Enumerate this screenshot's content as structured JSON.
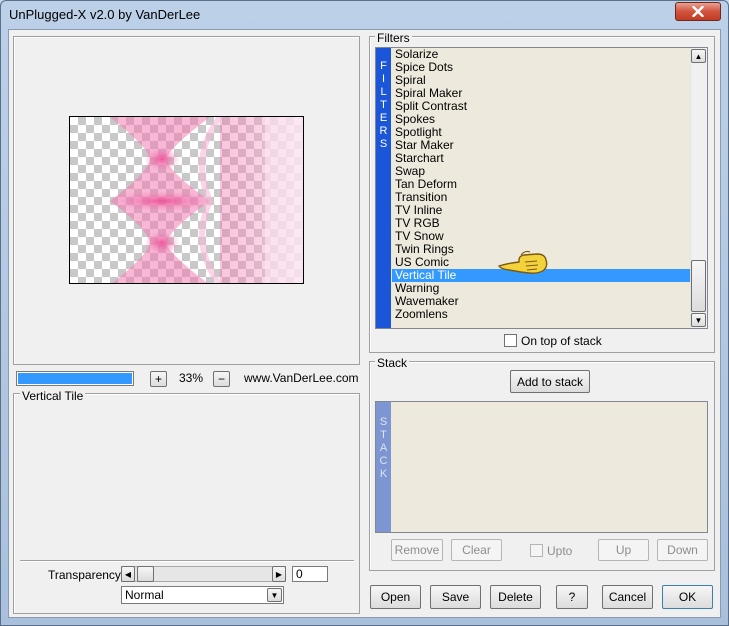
{
  "window": {
    "title": "UnPlugged-X v2.0 by VanDerLee"
  },
  "preview": {
    "progress": 1.0,
    "zoom": "33%",
    "zoom_in_label": "+",
    "zoom_out_label": "−",
    "website": "www.VanDerLee.com"
  },
  "settings": {
    "filter_name": "Vertical Tile",
    "transparency_label": "Transparency",
    "transparency_value": "0",
    "blend_mode": "Normal"
  },
  "filters": {
    "title": "Filters",
    "sidebar_letters": [
      "F",
      "I",
      "L",
      "T",
      "E",
      "R",
      "S"
    ],
    "items": [
      "Solarize",
      "Spice Dots",
      "Spiral",
      "Spiral Maker",
      "Split Contrast",
      "Spokes",
      "Spotlight",
      "Star Maker",
      "Starchart",
      "Swap",
      "Tan Deform",
      "Transition",
      "TV Inline",
      "TV RGB",
      "TV Snow",
      "Twin Rings",
      "US Comic",
      "Vertical Tile",
      "Warning",
      "Wavemaker",
      "Zoomlens"
    ],
    "selected": "Vertical Tile",
    "on_top_label": "On top of stack"
  },
  "stack": {
    "title": "Stack",
    "add_label": "Add to stack",
    "sidebar_letters": [
      "S",
      "T",
      "A",
      "C",
      "K"
    ],
    "remove_label": "Remove",
    "clear_label": "Clear",
    "upto_label": "Upto",
    "up_label": "Up",
    "down_label": "Down"
  },
  "buttons": {
    "open": "Open",
    "save": "Save",
    "delete": "Delete",
    "help": "?",
    "cancel": "Cancel",
    "ok": "OK"
  },
  "colors": {
    "selection": "#3399ff",
    "filters_bar": "#1b56d8",
    "stack_bar": "#7d95d1",
    "preview_pink": "#f06aa8"
  },
  "icons": {
    "close": "close-icon",
    "pointer": "pointing-hand-icon"
  }
}
